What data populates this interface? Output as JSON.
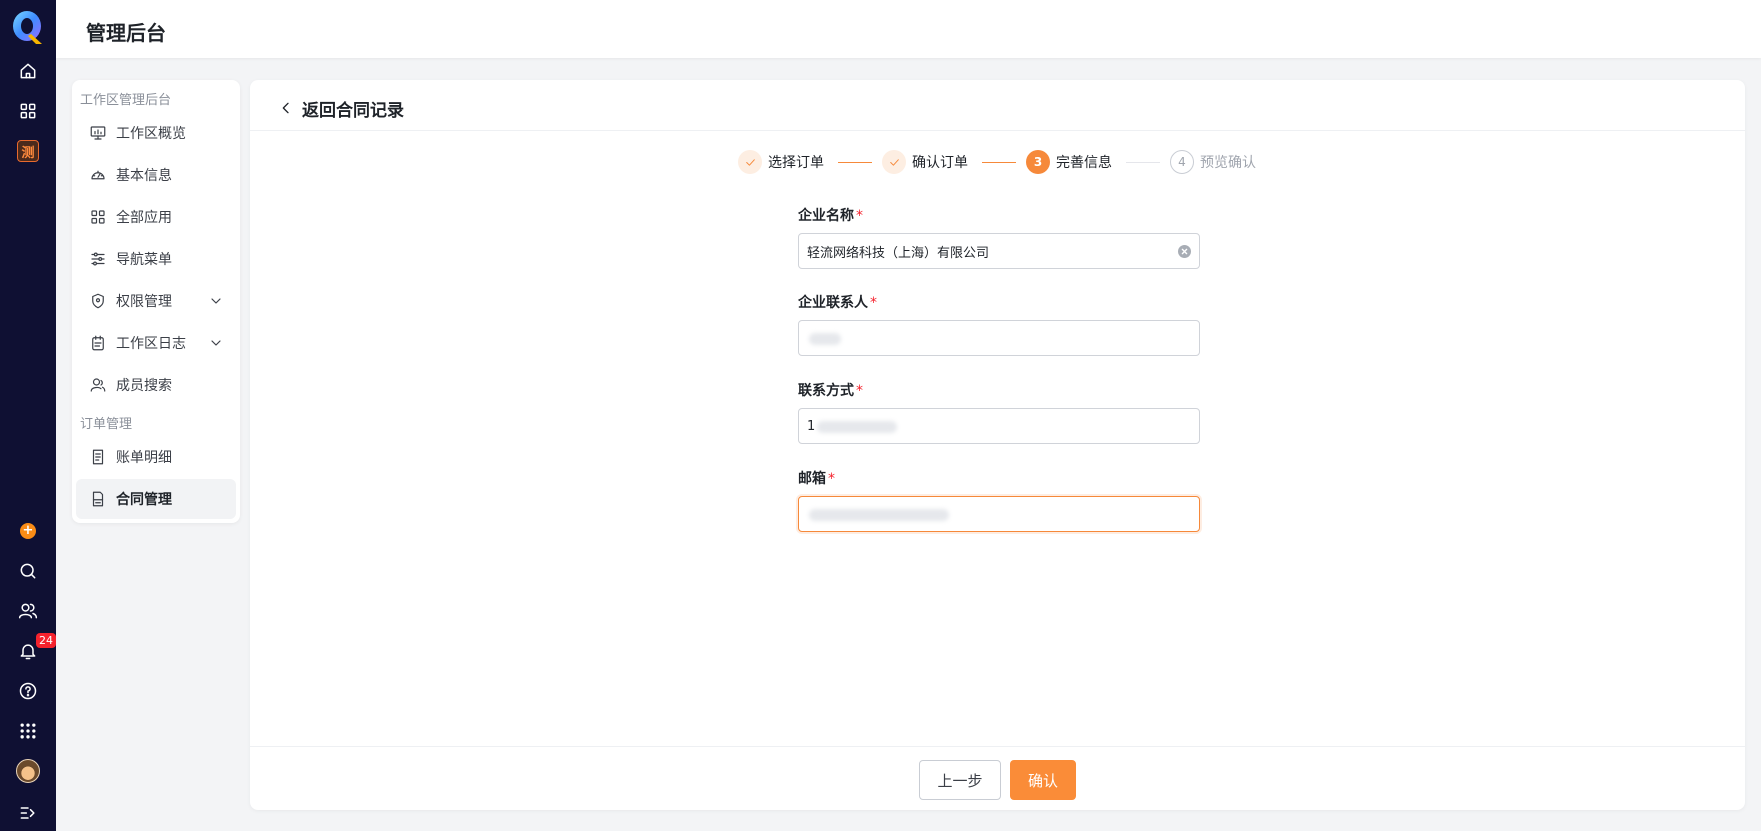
{
  "app": {
    "title": "管理后台",
    "rail_icons": [
      "logo-q",
      "home-icon",
      "grid-icon",
      "app-tile-icon",
      "plus-icon",
      "search-icon",
      "users-icon",
      "bell-icon",
      "help-icon",
      "apps-icon",
      "avatar",
      "expand-icon"
    ],
    "notification_count": "24",
    "app_tile_glyph": "测"
  },
  "sidebar": {
    "groups": [
      {
        "title": "工作区管理后台",
        "items": [
          {
            "label": "工作区概览",
            "icon": "monitor-chart-icon"
          },
          {
            "label": "基本信息",
            "icon": "dashboard-icon"
          },
          {
            "label": "全部应用",
            "icon": "grid-icon"
          },
          {
            "label": "导航菜单",
            "icon": "sliders-icon"
          },
          {
            "label": "权限管理",
            "icon": "shield-icon",
            "expandable": true
          },
          {
            "label": "工作区日志",
            "icon": "clipboard-icon",
            "expandable": true
          },
          {
            "label": "成员搜索",
            "icon": "user-search-icon"
          }
        ]
      },
      {
        "title": "订单管理",
        "items": [
          {
            "label": "账单明细",
            "icon": "receipt-icon"
          },
          {
            "label": "合同管理",
            "icon": "contract-icon",
            "active": true
          }
        ]
      }
    ]
  },
  "main": {
    "back_label": "返回合同记录",
    "steps": [
      {
        "index": "1",
        "label": "选择订单",
        "status": "done"
      },
      {
        "index": "2",
        "label": "确认订单",
        "status": "done"
      },
      {
        "index": "3",
        "label": "完善信息",
        "status": "current"
      },
      {
        "index": "4",
        "label": "预览确认",
        "status": "todo"
      }
    ],
    "form": {
      "company_name": {
        "label": "企业名称",
        "required": "*",
        "value": "轻流网络科技（上海）有限公司"
      },
      "contact_person": {
        "label": "企业联系人",
        "required": "*",
        "value": ""
      },
      "contact_method": {
        "label": "联系方式",
        "required": "*",
        "value": "1"
      },
      "email": {
        "label": "邮箱",
        "required": "*",
        "value": ""
      }
    },
    "buttons": {
      "prev": "上一步",
      "confirm": "确认"
    }
  },
  "colors": {
    "rail_bg": "#0f1033",
    "accent": "#fa8c38",
    "required": "#f5222d"
  }
}
